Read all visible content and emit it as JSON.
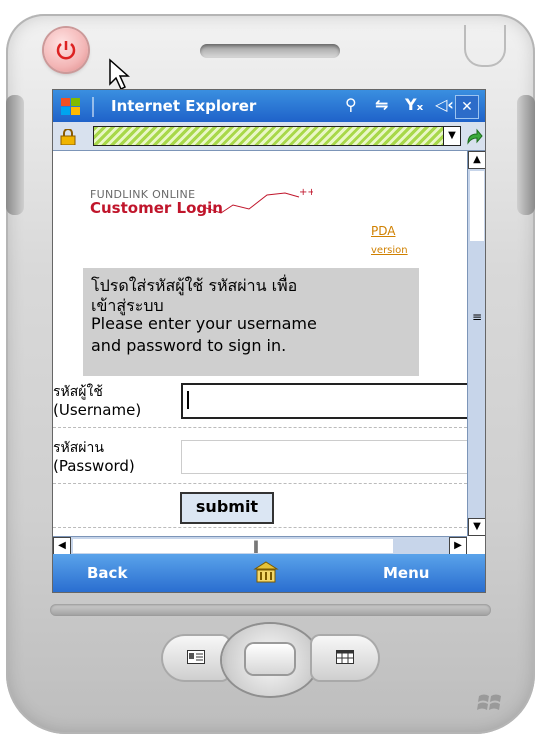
{
  "titlebar": {
    "app_title": "Internet Explorer"
  },
  "content": {
    "brand_small": "FUNDLINK ONLINE",
    "brand_title": "Customer Login",
    "pda_link": "PDA",
    "version_link": "version",
    "notice_lines": [
      "โปรดใส่รหัสผู้ใช้ รหัสผ่าน เพื่อ",
      "เข้าสู่ระบบ",
      "Please enter your username",
      "and password to sign in."
    ],
    "username_label_th": "รหัสผู้ใช้",
    "username_label_en": "(Username)",
    "password_label_th": "รหัสผ่าน",
    "password_label_en": "(Password)",
    "username_value": "",
    "password_value": "",
    "submit_label": "submit"
  },
  "softkeys": {
    "left": "Back",
    "right": "Menu"
  },
  "colors": {
    "title_blue": "#1f62c9",
    "brand_red": "#c0152b",
    "link_orange": "#d08000"
  }
}
